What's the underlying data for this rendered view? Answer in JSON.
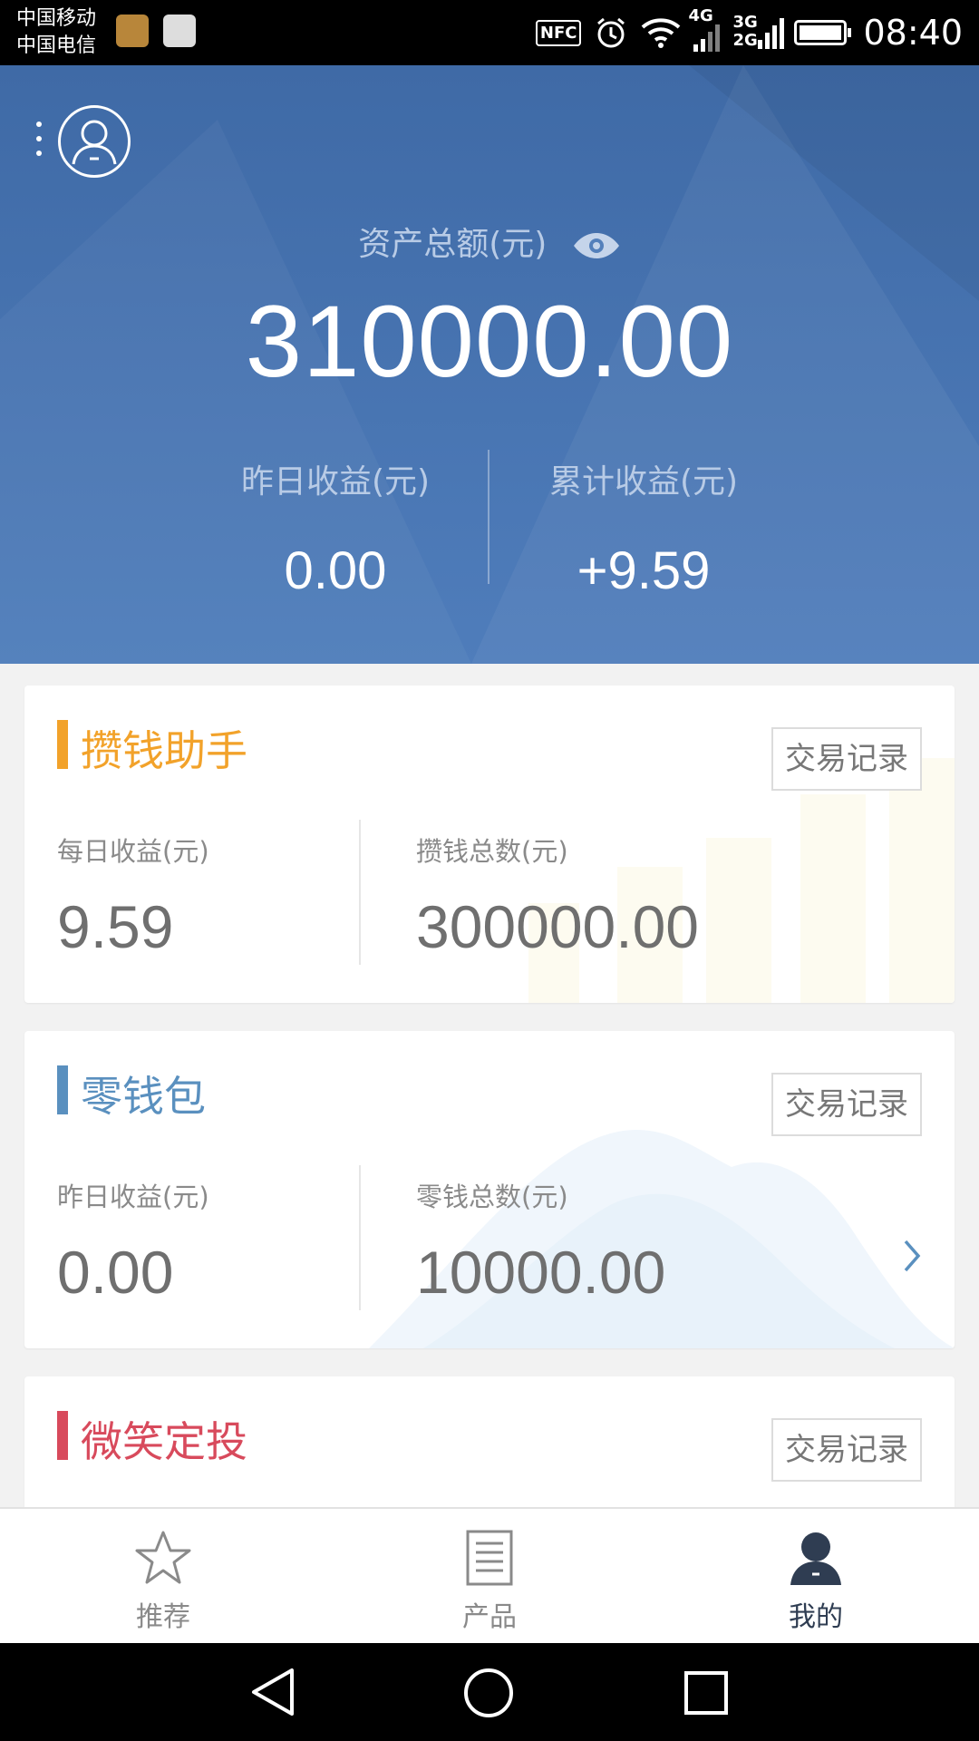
{
  "status_bar": {
    "carrier_1": "中国移动",
    "carrier_2": "中国电信",
    "nfc": "NFC",
    "net_4g": "4G",
    "net_3g": "3G",
    "net_2g": "2G",
    "time": "08:40"
  },
  "header": {
    "total_label": "资产总额(元)",
    "total_amount": "310000.00",
    "yesterday_label": "昨日收益(元)",
    "yesterday_value": "0.00",
    "cumulative_label": "累计收益(元)",
    "cumulative_value": "+9.59"
  },
  "cards": [
    {
      "title": "攒钱助手",
      "trade_button": "交易记录",
      "left_label": "每日收益(元)",
      "left_value": "9.59",
      "right_label": "攒钱总数(元)",
      "right_value": "300000.00"
    },
    {
      "title": "零钱包",
      "trade_button": "交易记录",
      "left_label": "昨日收益(元)",
      "left_value": "0.00",
      "right_label": "零钱总数(元)",
      "right_value": "10000.00"
    },
    {
      "title": "微笑定投",
      "trade_button": "交易记录"
    }
  ],
  "bottom_nav": [
    {
      "label": "推荐",
      "icon": "star-icon",
      "active": false
    },
    {
      "label": "产品",
      "icon": "document-icon",
      "active": false
    },
    {
      "label": "我的",
      "icon": "user-icon",
      "active": true
    }
  ],
  "colors": {
    "header_blue": "#4a77b4",
    "card1_accent": "#f2a22a",
    "card2_accent": "#5a90bf",
    "card3_accent": "#d84a5c",
    "nav_active": "#2f3d52",
    "nav_inactive": "#8a8a8a"
  }
}
